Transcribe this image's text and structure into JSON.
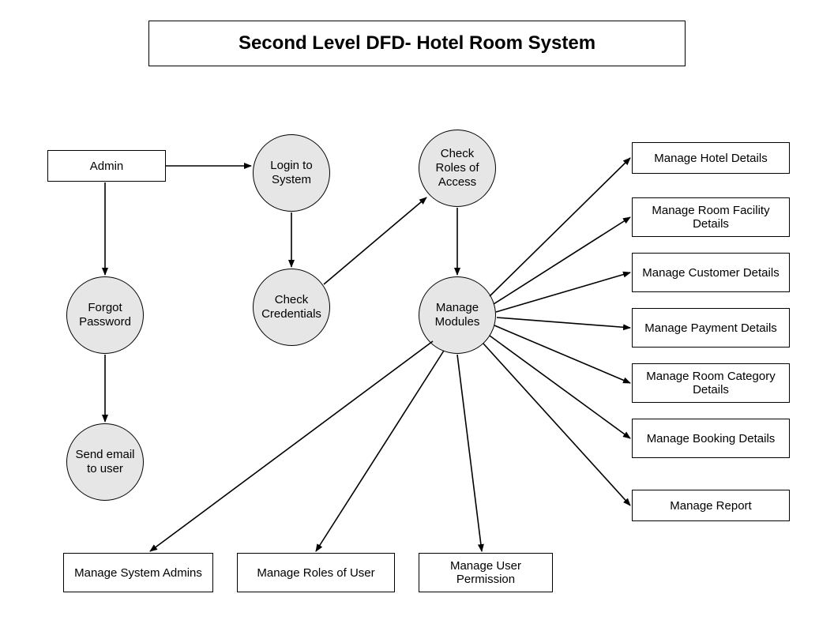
{
  "title": "Second Level DFD- Hotel Room System",
  "entities": {
    "admin": "Admin"
  },
  "processes": {
    "login": "Login to System",
    "forgot": "Forgot Password",
    "sendEmail": "Send email to user",
    "checkCred": "Check Credentials",
    "checkRoles": "Check Roles of Access",
    "manageModules": "Manage Modules"
  },
  "datastores": {
    "hotel": "Manage Hotel Details",
    "roomFacility": "Manage Room Facility Details",
    "customer": "Manage Customer Details",
    "payment": "Manage Payment Details",
    "roomCategory": "Manage Room Category Details",
    "booking": "Manage Booking Details",
    "report": "Manage Report",
    "sysAdmins": "Manage System Admins",
    "rolesUser": "Manage Roles of User",
    "userPerm": "Manage User Permission"
  }
}
